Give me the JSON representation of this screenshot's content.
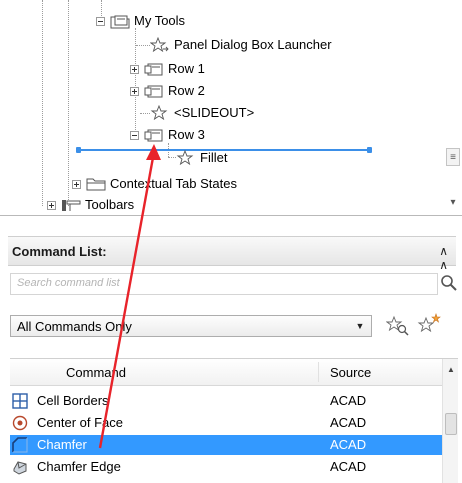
{
  "tree": {
    "items": [
      {
        "label": "My Tools",
        "icon": "toolbar-folder-icon"
      },
      {
        "label": "Panel Dialog Box Launcher",
        "icon": "star-command-icon"
      },
      {
        "label": "Row 1",
        "icon": "row-icon"
      },
      {
        "label": "Row 2",
        "icon": "row-icon"
      },
      {
        "label": "<SLIDEOUT>",
        "icon": "star-command-icon"
      },
      {
        "label": "Row 3",
        "icon": "row-icon"
      },
      {
        "label": "Fillet",
        "icon": "star-command-icon"
      },
      {
        "label": "Contextual Tab States",
        "icon": "folder-icon"
      },
      {
        "label": "Toolbars",
        "icon": "toolbar-icon"
      }
    ],
    "drop_indicator_color": "#3b8fe8"
  },
  "command_list": {
    "title": "Command List:",
    "search_placeholder": "Search command list",
    "filter_selected": "All Commands Only",
    "columns": {
      "command": "Command",
      "source": "Source"
    },
    "rows": [
      {
        "command": "Cell Borders",
        "source": "ACAD",
        "icon": "cell-borders-icon",
        "selected": false
      },
      {
        "command": "Center of Face",
        "source": "ACAD",
        "icon": "center-of-face-icon",
        "selected": false
      },
      {
        "command": "Chamfer",
        "source": "ACAD",
        "icon": "chamfer-icon",
        "selected": true
      },
      {
        "command": "Chamfer Edge",
        "source": "ACAD",
        "icon": "chamfer-edge-icon",
        "selected": false
      }
    ],
    "selection_color": "#3399ff"
  },
  "annotation": {
    "arrow_color": "#e8232a"
  }
}
